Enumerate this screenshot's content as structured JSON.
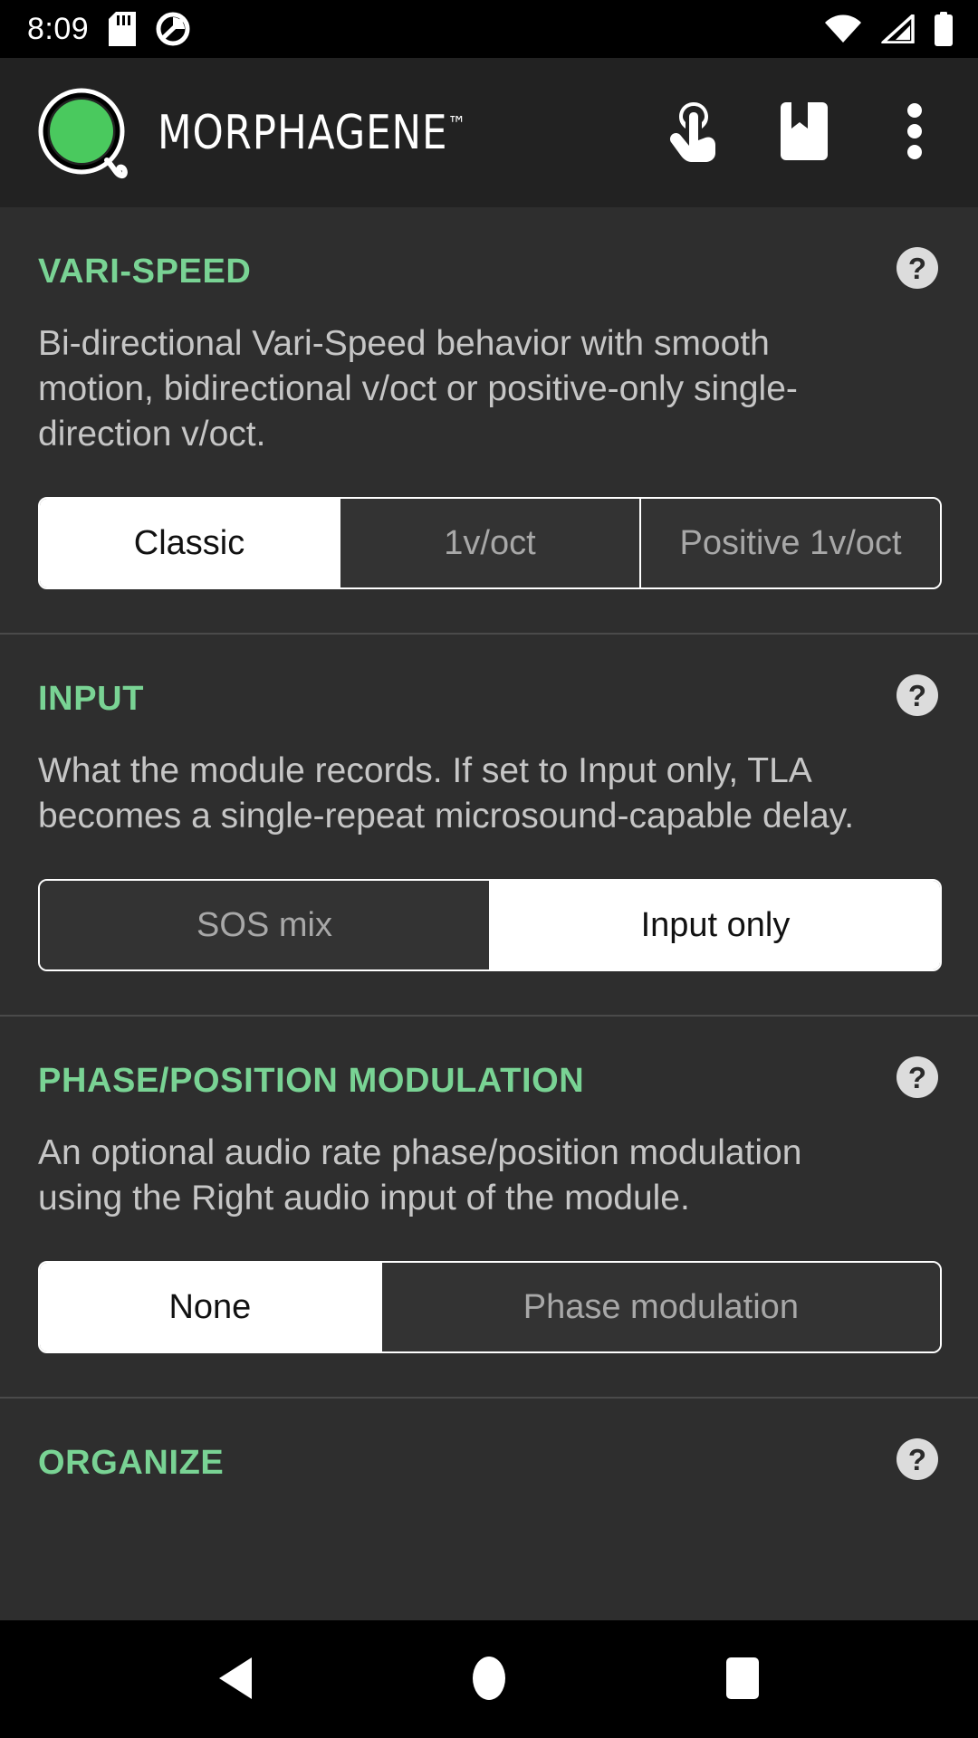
{
  "statusbar": {
    "clock": "8:09",
    "icons_left": [
      "sd-card-icon",
      "do-not-disturb-icon"
    ],
    "icons_right": [
      "wifi-icon",
      "cellular-signal-icon",
      "battery-icon"
    ]
  },
  "appbar": {
    "logo": "morphagene-logo-icon",
    "title": "MORPHAGENE",
    "trademark": "™",
    "actions": [
      {
        "name": "touch-gesture-icon",
        "label": "Touch gestures"
      },
      {
        "name": "bookmark-icon",
        "label": "Bookmarks"
      },
      {
        "name": "overflow-menu-icon",
        "label": "More options"
      }
    ]
  },
  "colors": {
    "accent_green": "#79d394",
    "logo_green": "#4ac95e",
    "appbar_bg": "#222222",
    "page_bg": "#2e2e2e",
    "selected_bg": "#ffffff",
    "selected_text": "#111111",
    "unselected_text": "#a8a8a8",
    "body_text": "#c6c6c6",
    "divider": "#4a4a4a"
  },
  "help_label": "?",
  "sections": [
    {
      "title": "VARI-SPEED",
      "description": "Bi-directional Vari-Speed behavior with smooth motion, bidirectional v/oct or positive-only single-direction v/oct.",
      "options": [
        {
          "label": "Classic",
          "selected": true
        },
        {
          "label": "1v/oct",
          "selected": false
        },
        {
          "label": "Positive 1v/oct",
          "selected": false
        }
      ]
    },
    {
      "title": "INPUT",
      "description": "What the module records. If set to Input only, TLA becomes a single-repeat microsound-capable delay.",
      "options": [
        {
          "label": "SOS mix",
          "selected": false
        },
        {
          "label": "Input only",
          "selected": true
        }
      ]
    },
    {
      "title": "PHASE/POSITION MODULATION",
      "description": "An optional audio rate phase/position modulation using the Right audio input of the module.",
      "options": [
        {
          "label": "None",
          "selected": true
        },
        {
          "label": "Phase modulation",
          "selected": false
        }
      ]
    },
    {
      "title": "ORGANIZE",
      "description": "",
      "options": []
    }
  ],
  "navbar": {
    "back": "back-icon",
    "home": "home-icon",
    "recents": "recents-icon"
  }
}
